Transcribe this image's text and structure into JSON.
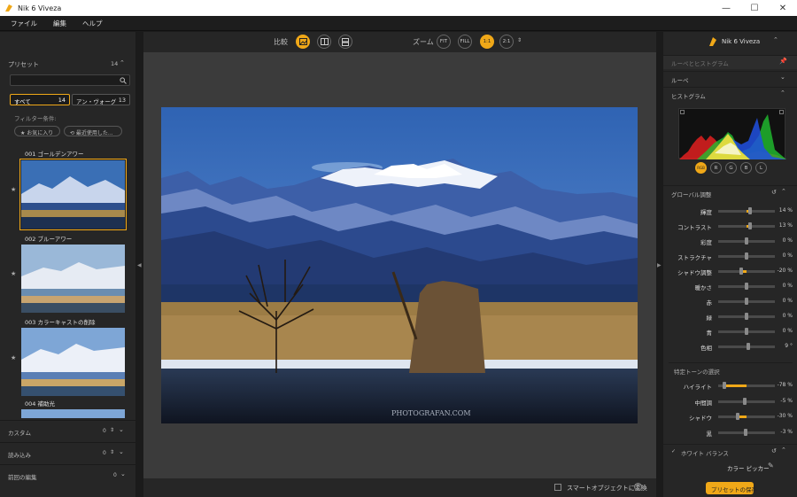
{
  "window": {
    "title": "Nik 6 Viveza",
    "minimize": "—",
    "maximize": "☐",
    "close": "✕"
  },
  "menu": [
    "ファイル",
    "編集",
    "ヘルプ"
  ],
  "left": {
    "presets_label": "プリセット",
    "presets_count": "14",
    "tab_all": "すべて",
    "tab_all_count": "14",
    "tab_avant": "アン・ヴォーグ",
    "tab_avant_count": "13",
    "filter_label": "フィルター条件:",
    "favorites": "★ お気に入り",
    "recent": "⟲ 最近使用した...",
    "items": [
      {
        "label": "001 ゴールデンアワー"
      },
      {
        "label": "002 ブルーアワー"
      },
      {
        "label": "003 カラーキャストの削除"
      },
      {
        "label": "004 補助光"
      }
    ],
    "custom_label": "カスタム",
    "custom_count": "0",
    "import_label": "読み込み",
    "import_count": "0",
    "prev_label": "前回の編集",
    "prev_count": "0"
  },
  "toolbar": {
    "compare_label": "比較",
    "zoom_label": "ズーム",
    "zoom_fit": "FIT",
    "zoom_fill": "FILL",
    "zoom_11": "1:1",
    "zoom_21": "2:1"
  },
  "image": {
    "watermark": "PHOTOGRAFAN.COM"
  },
  "bottom": {
    "smart_object": "スマートオブジェクトに変換"
  },
  "right": {
    "brand": "Nik 6 Viveza",
    "loupe_hist": "ルーペとヒストグラム",
    "loupe": "ルーペ",
    "histogram": "ヒストグラム",
    "hist_channels": [
      "RGB",
      "R",
      "G",
      "B",
      "L"
    ],
    "global_adjust": "グローバル調整",
    "sliders": [
      {
        "label": "輝度",
        "value": "14 %",
        "pct": 14
      },
      {
        "label": "コントラスト",
        "value": "13 %",
        "pct": 13
      },
      {
        "label": "彩度",
        "value": "0 %",
        "pct": 0
      },
      {
        "label": "ストラクチャ",
        "value": "0 %",
        "pct": 0
      },
      {
        "label": "シャドウ調整",
        "value": "-20 %",
        "pct": -20
      },
      {
        "label": "暖かさ",
        "value": "0 %",
        "pct": 0
      },
      {
        "label": "赤",
        "value": "0 %",
        "pct": 0
      },
      {
        "label": "緑",
        "value": "0 %",
        "pct": 0
      },
      {
        "label": "青",
        "value": "0 %",
        "pct": 0
      },
      {
        "label": "色相",
        "value": "9 °",
        "pct": 5
      }
    ],
    "tone_label": "特定トーンの選択",
    "tone_sliders": [
      {
        "label": "ハイライト",
        "value": "-78 %",
        "pct": -78
      },
      {
        "label": "中間調",
        "value": "-5 %",
        "pct": -5
      },
      {
        "label": "シャドウ",
        "value": "-30 %",
        "pct": -30
      },
      {
        "label": "黒",
        "value": "-3 %",
        "pct": -3
      }
    ],
    "white_balance": "ホワイト バランス",
    "color_picker": "カラー ピッカー",
    "save_preset": "プリセットの保存"
  },
  "colors": {
    "accent": "#f0a818",
    "panel": "#262626",
    "canvas": "#3b3b3b"
  }
}
